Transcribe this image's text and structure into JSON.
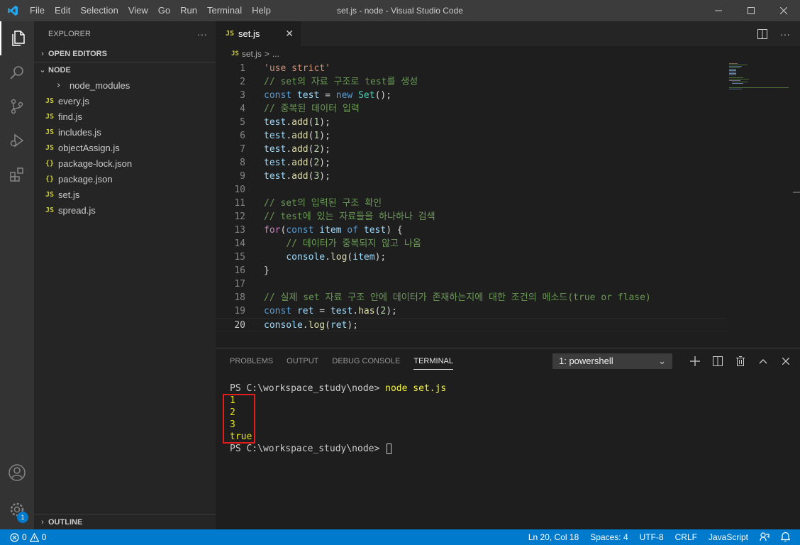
{
  "window": {
    "title": "set.js - node - Visual Studio Code",
    "menu": [
      "File",
      "Edit",
      "Selection",
      "View",
      "Go",
      "Run",
      "Terminal",
      "Help"
    ]
  },
  "activity_bar": {
    "items": [
      "explorer-icon",
      "search-icon",
      "source-control-icon",
      "run-debug-icon",
      "extensions-icon"
    ],
    "bottom": [
      "account-icon",
      "manage-gear-icon"
    ],
    "manage_badge": "1"
  },
  "sidebar": {
    "header": "EXPLORER",
    "more": "···",
    "sections": {
      "open_editors": "OPEN EDITORS",
      "node": "NODE",
      "outline": "OUTLINE"
    },
    "tree": [
      {
        "type": "folder",
        "icon": "",
        "label": "node_modules"
      },
      {
        "type": "js",
        "icon": "JS",
        "label": "every.js"
      },
      {
        "type": "js",
        "icon": "JS",
        "label": "find.js"
      },
      {
        "type": "js",
        "icon": "JS",
        "label": "includes.js"
      },
      {
        "type": "js",
        "icon": "JS",
        "label": "objectAssign.js"
      },
      {
        "type": "json",
        "icon": "{}",
        "label": "package-lock.json"
      },
      {
        "type": "json",
        "icon": "{}",
        "label": "package.json"
      },
      {
        "type": "js",
        "icon": "JS",
        "label": "set.js"
      },
      {
        "type": "js",
        "icon": "JS",
        "label": "spread.js"
      }
    ]
  },
  "editor": {
    "tab": {
      "icon": "JS",
      "label": "set.js",
      "close": "✕"
    },
    "breadcrumb": {
      "icon": "JS",
      "file": "set.js",
      "sep": ">",
      "rest": "..."
    },
    "lines": [
      {
        "n": "1",
        "tokens": [
          [
            "str",
            "'use strict'"
          ]
        ]
      },
      {
        "n": "2",
        "tokens": [
          [
            "cmt",
            "// set의 자료 구조로 test를 생성"
          ]
        ]
      },
      {
        "n": "3",
        "tokens": [
          [
            "kw",
            "const"
          ],
          [
            "pun",
            " "
          ],
          [
            "var",
            "test"
          ],
          [
            "pun",
            " = "
          ],
          [
            "kw",
            "new"
          ],
          [
            "pun",
            " "
          ],
          [
            "cls",
            "Set"
          ],
          [
            "pun",
            "();"
          ]
        ]
      },
      {
        "n": "4",
        "tokens": [
          [
            "cmt",
            "// 중복된 데이터 입력"
          ]
        ]
      },
      {
        "n": "5",
        "tokens": [
          [
            "var",
            "test"
          ],
          [
            "pun",
            "."
          ],
          [
            "fn",
            "add"
          ],
          [
            "pun",
            "("
          ],
          [
            "num",
            "1"
          ],
          [
            "pun",
            ");"
          ]
        ]
      },
      {
        "n": "6",
        "tokens": [
          [
            "var",
            "test"
          ],
          [
            "pun",
            "."
          ],
          [
            "fn",
            "add"
          ],
          [
            "pun",
            "("
          ],
          [
            "num",
            "1"
          ],
          [
            "pun",
            ");"
          ]
        ]
      },
      {
        "n": "7",
        "tokens": [
          [
            "var",
            "test"
          ],
          [
            "pun",
            "."
          ],
          [
            "fn",
            "add"
          ],
          [
            "pun",
            "("
          ],
          [
            "num",
            "2"
          ],
          [
            "pun",
            ");"
          ]
        ]
      },
      {
        "n": "8",
        "tokens": [
          [
            "var",
            "test"
          ],
          [
            "pun",
            "."
          ],
          [
            "fn",
            "add"
          ],
          [
            "pun",
            "("
          ],
          [
            "num",
            "2"
          ],
          [
            "pun",
            ");"
          ]
        ]
      },
      {
        "n": "9",
        "tokens": [
          [
            "var",
            "test"
          ],
          [
            "pun",
            "."
          ],
          [
            "fn",
            "add"
          ],
          [
            "pun",
            "("
          ],
          [
            "num",
            "3"
          ],
          [
            "pun",
            ");"
          ]
        ]
      },
      {
        "n": "10",
        "tokens": []
      },
      {
        "n": "11",
        "tokens": [
          [
            "cmt",
            "// set의 입력된 구조 확인"
          ]
        ]
      },
      {
        "n": "12",
        "tokens": [
          [
            "cmt",
            "// test에 있는 자료들을 하나하나 검색"
          ]
        ]
      },
      {
        "n": "13",
        "tokens": [
          [
            "ctl",
            "for"
          ],
          [
            "pun",
            "("
          ],
          [
            "kw",
            "const"
          ],
          [
            "pun",
            " "
          ],
          [
            "var",
            "item"
          ],
          [
            "pun",
            " "
          ],
          [
            "kw",
            "of"
          ],
          [
            "pun",
            " "
          ],
          [
            "var",
            "test"
          ],
          [
            "pun",
            ") {"
          ]
        ]
      },
      {
        "n": "14",
        "tokens": [
          [
            "pun",
            "    "
          ],
          [
            "cmt",
            "// 데이터가 중복되지 않고 나옴"
          ]
        ]
      },
      {
        "n": "15",
        "tokens": [
          [
            "pun",
            "    "
          ],
          [
            "var",
            "console"
          ],
          [
            "pun",
            "."
          ],
          [
            "fn",
            "log"
          ],
          [
            "pun",
            "("
          ],
          [
            "var",
            "item"
          ],
          [
            "pun",
            ");"
          ]
        ]
      },
      {
        "n": "16",
        "tokens": [
          [
            "pun",
            "}"
          ]
        ]
      },
      {
        "n": "17",
        "tokens": []
      },
      {
        "n": "18",
        "tokens": [
          [
            "cmt",
            "// 실제 set 자료 구조 안에 데이터가 존재하는지에 대한 조건의 메소드(true or flase)"
          ]
        ]
      },
      {
        "n": "19",
        "tokens": [
          [
            "kw",
            "const"
          ],
          [
            "pun",
            " "
          ],
          [
            "var",
            "ret"
          ],
          [
            "pun",
            " = "
          ],
          [
            "var",
            "test"
          ],
          [
            "pun",
            "."
          ],
          [
            "fn",
            "has"
          ],
          [
            "pun",
            "("
          ],
          [
            "num",
            "2"
          ],
          [
            "pun",
            ");"
          ]
        ]
      },
      {
        "n": "20",
        "tokens": [
          [
            "var",
            "console"
          ],
          [
            "pun",
            "."
          ],
          [
            "fn",
            "log"
          ],
          [
            "pun",
            "("
          ],
          [
            "var",
            "ret"
          ],
          [
            "pun",
            ");"
          ]
        ]
      }
    ]
  },
  "panel": {
    "tabs": [
      "PROBLEMS",
      "OUTPUT",
      "DEBUG CONSOLE",
      "TERMINAL"
    ],
    "active_tab": "TERMINAL",
    "terminal_select": "1: powershell",
    "terminal": {
      "prompt1": "PS C:\\workspace_study\\node> ",
      "command": "node set.js",
      "output": [
        "1",
        "2",
        "3",
        "true"
      ],
      "prompt2": "PS C:\\workspace_study\\node> "
    }
  },
  "statusbar": {
    "errors": "0",
    "warnings": "0",
    "position": "Ln 20, Col 18",
    "spaces": "Spaces: 4",
    "encoding": "UTF-8",
    "eol": "CRLF",
    "language": "JavaScript"
  },
  "colors": {
    "accent": "#007acc",
    "highlight_box": "#e31c1c"
  }
}
